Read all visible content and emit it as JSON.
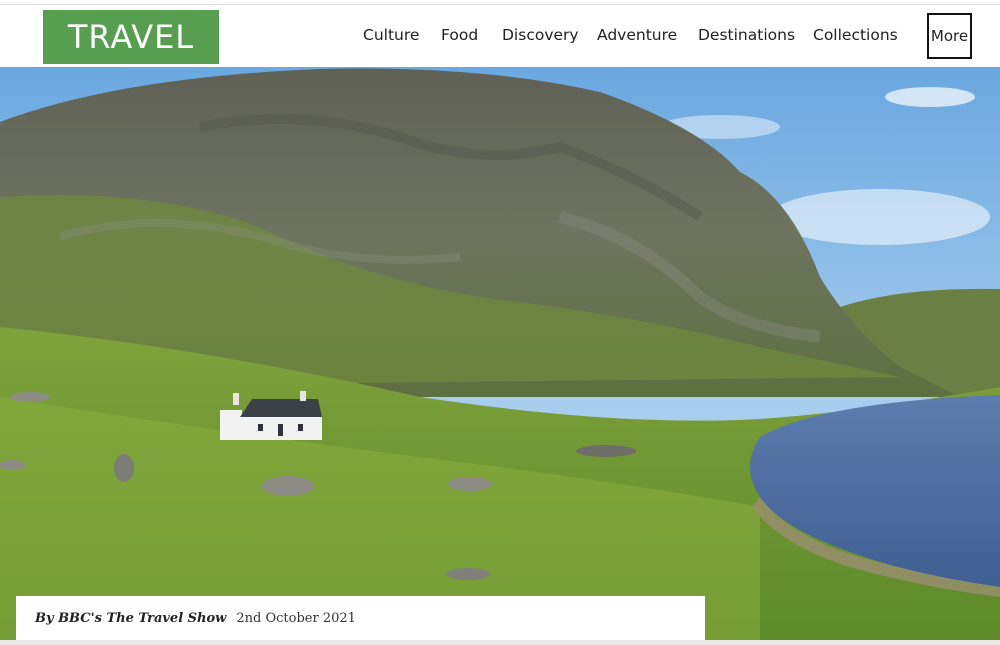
{
  "header": {
    "logo": "TRAVEL",
    "nav": [
      "Culture",
      "Food",
      "Discovery",
      "Adventure",
      "Destinations",
      "Collections"
    ],
    "more_label": "More"
  },
  "hero": {
    "image": "scottish-highland-cottage-by-loch"
  },
  "caption": {
    "byline": "By BBC's The Travel Show",
    "date": "2nd October 2021"
  },
  "colors": {
    "brand_green": "#589e50"
  }
}
